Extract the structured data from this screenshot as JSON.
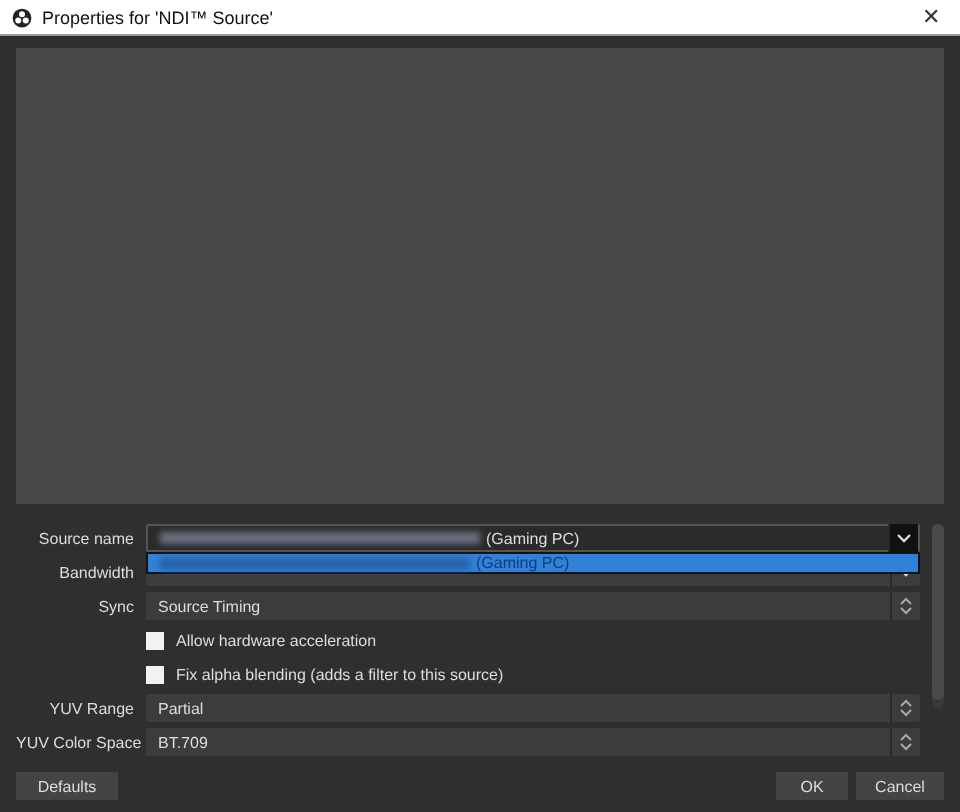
{
  "window": {
    "title": "Properties for 'NDI™ Source'",
    "close": "✕"
  },
  "fields": [
    {
      "kind": "dropdown",
      "label": "Source name",
      "value": "(Gaming PC)",
      "redacted": true,
      "open": true,
      "popup_value": "(Gaming PC)"
    },
    {
      "kind": "dropdown",
      "label": "Bandwidth"
    },
    {
      "kind": "spin",
      "label": "Sync",
      "value": "Source Timing"
    },
    {
      "kind": "checkbox",
      "label": "Allow hardware acceleration",
      "checked": false
    },
    {
      "kind": "checkbox",
      "label": "Fix alpha blending (adds a filter to this source)",
      "checked": false
    },
    {
      "kind": "spin",
      "label": "YUV Range",
      "value": "Partial"
    },
    {
      "kind": "spin",
      "label": "YUV Color Space",
      "value": "BT.709"
    }
  ],
  "buttons": {
    "defaults": "Defaults",
    "ok": "OK",
    "cancel": "Cancel"
  }
}
